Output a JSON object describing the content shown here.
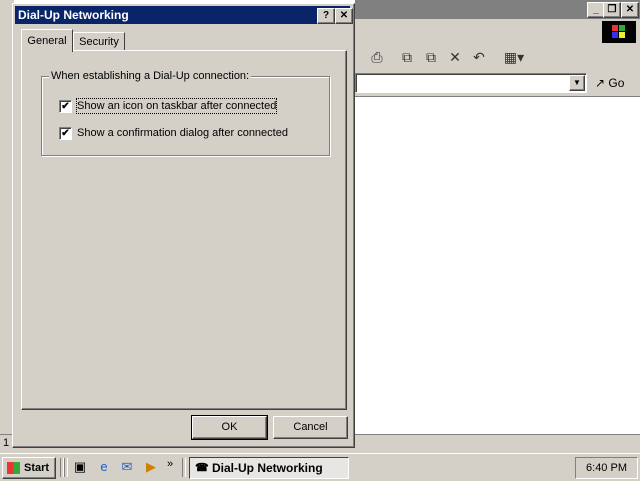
{
  "dialog": {
    "title": "Dial-Up Networking",
    "help_glyph": "?",
    "close_glyph": "✕",
    "tabs": [
      {
        "label": "General",
        "selected": true
      },
      {
        "label": "Security",
        "selected": false
      }
    ],
    "group_label": "When establishing a Dial-Up connection:",
    "options": [
      {
        "label": "Show an icon on taskbar after connected",
        "checked": true
      },
      {
        "label": "Show a confirmation dialog after connected",
        "checked": true
      }
    ],
    "check_glyph": "✔",
    "ok_label": "OK",
    "cancel_label": "Cancel"
  },
  "background_window": {
    "minimize_glyph": "_",
    "maximize_glyph": "❐",
    "close_glyph": "✕",
    "go_label": "Go",
    "dropdown_glyph": "▼",
    "status_text": "1"
  },
  "taskbar": {
    "start_label": "Start",
    "more_glyph": "»",
    "task_label": "Dial-Up Networking",
    "clock": "6:40 PM"
  }
}
